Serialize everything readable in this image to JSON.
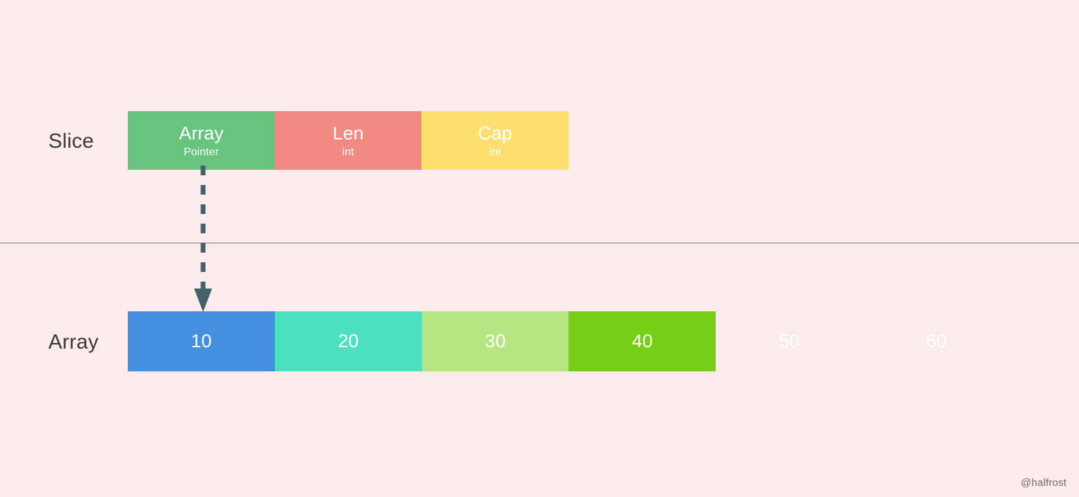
{
  "background_color": "#fbebeb",
  "divider_color": "#b3b0b0",
  "rows": {
    "slice": {
      "label": "Slice",
      "cells": [
        {
          "title": "Array",
          "subtitle": "Pointer",
          "color": "#67c37e"
        },
        {
          "title": "Len",
          "subtitle": "int",
          "color": "#f08a82"
        },
        {
          "title": "Cap",
          "subtitle": "int",
          "color": "#fcdf6e"
        }
      ]
    },
    "array": {
      "label": "Array",
      "cells": [
        {
          "value": "10",
          "color": "#458fe0"
        },
        {
          "value": "20",
          "color": "#4ae0c0"
        },
        {
          "value": "30",
          "color": "#b6e681"
        },
        {
          "value": "40",
          "color": "#76cf14"
        },
        {
          "value": "50",
          "color": "#b munched"
        },
        {
          "value": "60",
          "color": "#fbb košík"
        }
      ]
    }
  },
  "pointer": {
    "icon": "dashed-arrow-down-icon",
    "color": "#46606a",
    "from": "Array Pointer",
    "to": "Array element 10"
  },
  "watermark": {
    "text": "@halfrost"
  }
}
